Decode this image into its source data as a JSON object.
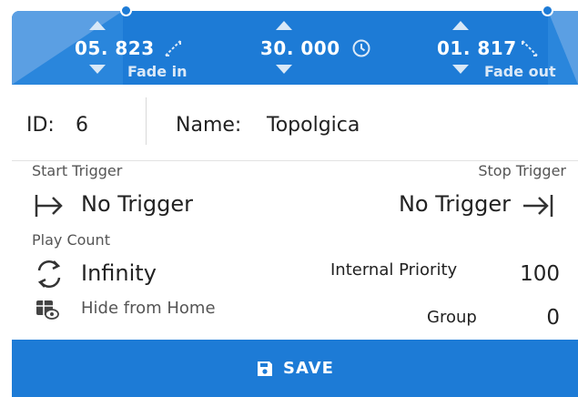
{
  "header": {
    "fade_in": {
      "value": "05. 823",
      "label": "Fade in"
    },
    "duration": {
      "value": "30. 000"
    },
    "fade_out": {
      "value": "01. 817",
      "label": "Fade out"
    }
  },
  "item": {
    "id_label": "ID:",
    "id_value": "6",
    "name_label": "Name:",
    "name_value": "Topolgica"
  },
  "triggers": {
    "start_label": "Start Trigger",
    "start_value": "No Trigger",
    "stop_label": "Stop Trigger",
    "stop_value": "No Trigger"
  },
  "play": {
    "label": "Play Count",
    "value": "Infinity"
  },
  "priority": {
    "label": "Internal Priority",
    "value": "100"
  },
  "home": {
    "label": "Hide from Home"
  },
  "group": {
    "label": "Group",
    "value": "0"
  },
  "save_button": {
    "label": "SAVE"
  },
  "colors": {
    "accent": "#1d7bd6",
    "band_light": "#5b9fe3"
  }
}
